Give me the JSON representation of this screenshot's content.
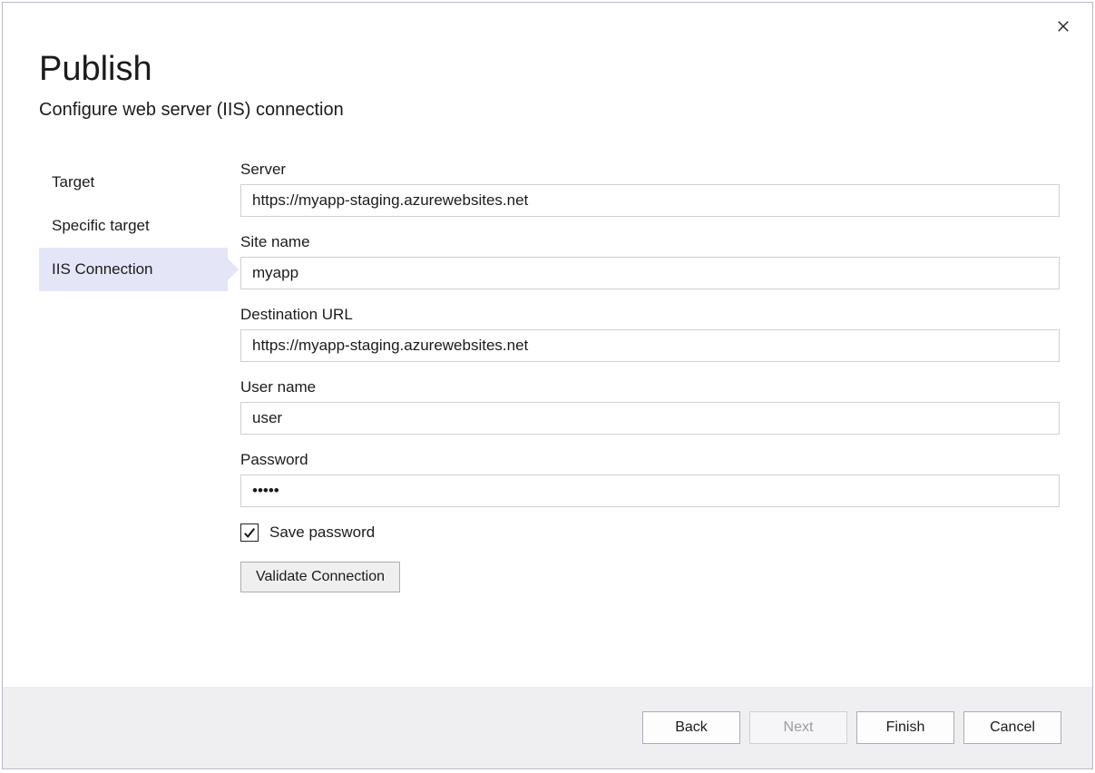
{
  "header": {
    "title": "Publish",
    "subtitle": "Configure web server (IIS) connection"
  },
  "sidebar": {
    "steps": [
      {
        "label": "Target",
        "active": false
      },
      {
        "label": "Specific target",
        "active": false
      },
      {
        "label": "IIS Connection",
        "active": true
      }
    ]
  },
  "form": {
    "server_label": "Server",
    "server_value": "https://myapp-staging.azurewebsites.net",
    "sitename_label": "Site name",
    "sitename_value": "myapp",
    "desturl_label": "Destination URL",
    "desturl_value": "https://myapp-staging.azurewebsites.net",
    "username_label": "User name",
    "username_value": "user",
    "password_label": "Password",
    "password_value": "•••••",
    "save_password_label": "Save password",
    "save_password_checked": true,
    "validate_label": "Validate Connection"
  },
  "footer": {
    "back": "Back",
    "next": "Next",
    "finish": "Finish",
    "cancel": "Cancel",
    "next_enabled": false
  }
}
